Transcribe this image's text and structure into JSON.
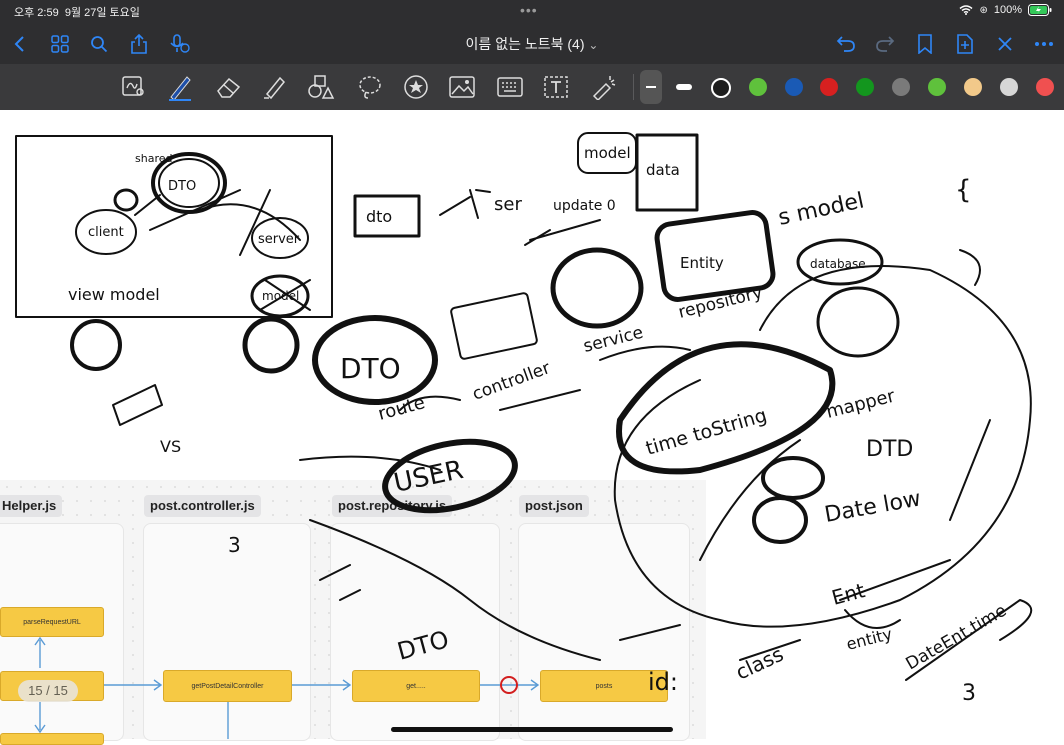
{
  "status_bar": {
    "time": "오후 2:59",
    "date": "9월 27일 토요일",
    "wifi": "wifi",
    "battery": "100%"
  },
  "nav": {
    "title": "이름 없는 노트북 (4)",
    "title_chevron": "⌄"
  },
  "colors": {
    "swatches": [
      "#1e1e1e",
      "#5fc13c",
      "#1a5ab5",
      "#d72020",
      "#13961e",
      "#7a7a7a",
      "#5fc13c",
      "#f2c98a",
      "#d6d6d6",
      "#f05050"
    ],
    "accent": "#2f86f6",
    "node": "#f6c944"
  },
  "embedded_diagram": {
    "tabs": [
      "Helper.js",
      "post.controller.js",
      "post.repository.js",
      "post.json"
    ],
    "nodes": {
      "parse": "parseRequestURL",
      "controller": "getPostDetailController",
      "repo": "get.....",
      "posts": "posts"
    }
  },
  "page_indicator": "15 / 15",
  "handwriting": {
    "shared": "shared",
    "dto_top": "DTO",
    "client": "client",
    "server": "server",
    "model": "model",
    "view_model": "view model",
    "dto": "dto",
    "ser": "ser",
    "update": "update 0",
    "model_box": "model",
    "data_box": "data",
    "entity": "Entity",
    "repository": "repository",
    "service": "service",
    "controller": "controller",
    "route": "route",
    "dto_big": "DTO",
    "user": "USER",
    "database": "database",
    "time_to_string": "time toString",
    "mapper": "mapper",
    "dtd": "DTD",
    "date_low": "Date low",
    "ent": "Ent",
    "class_label": "class",
    "entity2": "entity",
    "dateent": "DateEnt.time",
    "three": "3",
    "dto_mid": "DTO",
    "vs": "VS",
    "id": "id:",
    "smodel": "s model",
    "brace": "{"
  }
}
